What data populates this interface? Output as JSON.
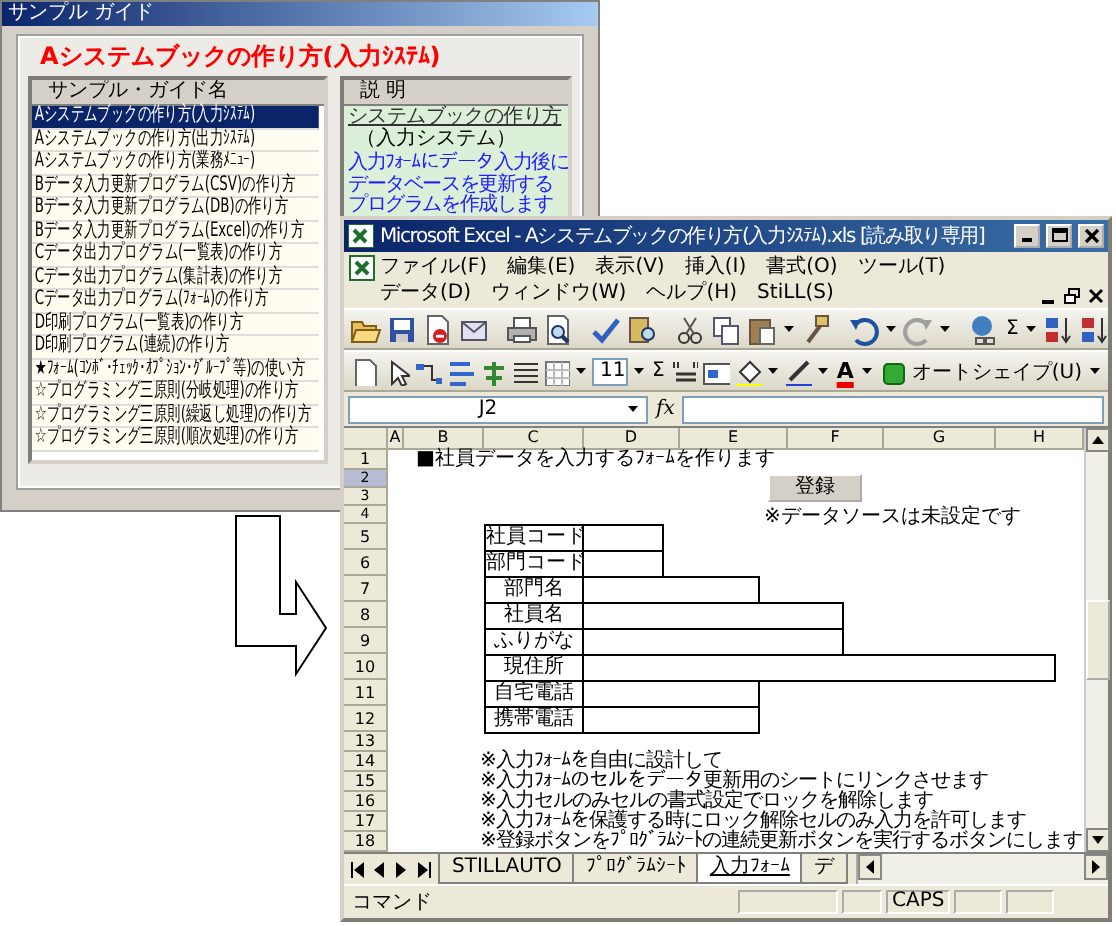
{
  "guide_window": {
    "title": "サンプル ガイド",
    "heading": "Aシステムブックの作り方(入力ｼｽﾃﾑ)",
    "list": {
      "header": "サンプル・ガイド名",
      "items": [
        {
          "label": "Aシステムブックの作り方(入力ｼｽﾃﾑ)",
          "selected": true
        },
        {
          "label": "Aシステムブックの作り方(出力ｼｽﾃﾑ)",
          "selected": false
        },
        {
          "label": "Aシステムブックの作り方(業務ﾒﾆｭｰ)",
          "selected": false
        },
        {
          "label": "Bデータ入力更新プログラム(CSV)の作り方",
          "selected": false
        },
        {
          "label": "Bデータ入力更新プログラム(DB)の作り方",
          "selected": false
        },
        {
          "label": "Bデータ入力更新プログラム(Excel)の作り方",
          "selected": false
        },
        {
          "label": "Cデータ出力プログラム(一覧表)の作り方",
          "selected": false
        },
        {
          "label": "Cデータ出力プログラム(集計表)の作り方",
          "selected": false
        },
        {
          "label": "Cデータ出力プログラム(ﾌｫｰﾑ)の作り方",
          "selected": false
        },
        {
          "label": "D印刷プログラム(一覧表)の作り方",
          "selected": false
        },
        {
          "label": "D印刷プログラム(連続)の作り方",
          "selected": false
        },
        {
          "label": "★ﾌｫｰﾑ(ｺﾝﾎﾞ･ﾁｪｯｸ･ｵﾌﾟｼｮﾝ･ｸﾞﾙｰﾌﾟ等)の使い方",
          "selected": false
        },
        {
          "label": "☆プログラミング三原則(分岐処理)の作り方",
          "selected": false
        },
        {
          "label": "☆プログラミング三原則(繰返し処理)の作り方",
          "selected": false
        },
        {
          "label": "☆プログラミング三原則(順次処理)の作り方",
          "selected": false
        }
      ]
    },
    "description": {
      "header": "説 明",
      "title": "システムブックの作り方",
      "subtitle": "（入力システム）",
      "lines": [
        "入力ﾌｫｰﾑにデータ入力後に",
        "データベースを更新する",
        "プログラムを作成します"
      ]
    }
  },
  "excel_window": {
    "title": "Microsoft Excel - Aシステムブックの作り方(入力ｼｽﾃﾑ).xls [読み取り専用]",
    "menus": [
      "ファイル(F)",
      "編集(E)",
      "表示(V)",
      "挿入(I)",
      "書式(O)",
      "ツール(T)",
      "データ(D)",
      "ウィンドウ(W)",
      "ヘルプ(H)",
      "StiLL(S)"
    ],
    "standard_toolbar": {
      "autosum": "Σ"
    },
    "drawing_toolbar": {
      "font_size": "11",
      "sum": "Σ",
      "font_color": "A",
      "autoshape": "オートシェイプ(U)"
    },
    "name_box": "J2",
    "formula_label": "fx",
    "columns": [
      "A",
      "B",
      "C",
      "D",
      "E",
      "F",
      "G",
      "H"
    ],
    "rows": [
      {
        "number": "1",
        "selected": false,
        "kind": "title",
        "text": "■社員データを入力するﾌｫｰﾑを作ります"
      },
      {
        "number": "2",
        "selected": true,
        "kind": "button",
        "text": "登録"
      },
      {
        "number": "3",
        "selected": false,
        "kind": "empty"
      },
      {
        "number": "4",
        "selected": false,
        "kind": "note",
        "text": "※データソースは未設定です"
      },
      {
        "number": "5",
        "selected": false,
        "kind": "short_field",
        "text": "社員コード"
      },
      {
        "number": "6",
        "selected": false,
        "kind": "short_field",
        "text": "部門コード"
      },
      {
        "number": "7",
        "selected": false,
        "kind": "medium_field",
        "text": "部門名"
      },
      {
        "number": "8",
        "selected": false,
        "kind": "long_field",
        "text": "社員名"
      },
      {
        "number": "9",
        "selected": false,
        "kind": "long_field",
        "text": "ふりがな"
      },
      {
        "number": "10",
        "selected": false,
        "kind": "wide_field",
        "text": "現住所"
      },
      {
        "number": "11",
        "selected": false,
        "kind": "medium_field",
        "text": "自宅電話"
      },
      {
        "number": "12",
        "selected": false,
        "kind": "medium_field",
        "text": "携帯電話"
      },
      {
        "number": "13",
        "selected": false,
        "kind": "empty"
      },
      {
        "number": "14",
        "selected": false,
        "kind": "remark",
        "text": "※入力ﾌｫｰﾑを自由に設計して"
      },
      {
        "number": "15",
        "selected": false,
        "kind": "remark",
        "text": "※入力ﾌｫｰﾑのセルをデータ更新用のシートにリンクさせます"
      },
      {
        "number": "16",
        "selected": false,
        "kind": "remark",
        "text": "※入力セルのみセルの書式設定でロックを解除します"
      },
      {
        "number": "17",
        "selected": false,
        "kind": "remark",
        "text": "※入力ﾌｫｰﾑを保護する時にロック解除セルのみ入力を許可します"
      },
      {
        "number": "18",
        "selected": false,
        "kind": "remark",
        "text": "※登録ボタンをﾌﾟﾛｸﾞﾗﾑｼｰﾄの連続更新ボタンを実行するボタンにします"
      }
    ],
    "sheet_tabs": [
      {
        "label": "STILLAUTO",
        "selected": false
      },
      {
        "label": "ﾌﾟﾛｸﾞﾗﾑｼｰﾄ",
        "selected": false
      },
      {
        "label": "入力ﾌｫｰﾑ",
        "selected": true
      },
      {
        "label": "デ",
        "selected": false
      }
    ],
    "status_bar": {
      "mode": "コマンド",
      "caps": "CAPS"
    }
  }
}
